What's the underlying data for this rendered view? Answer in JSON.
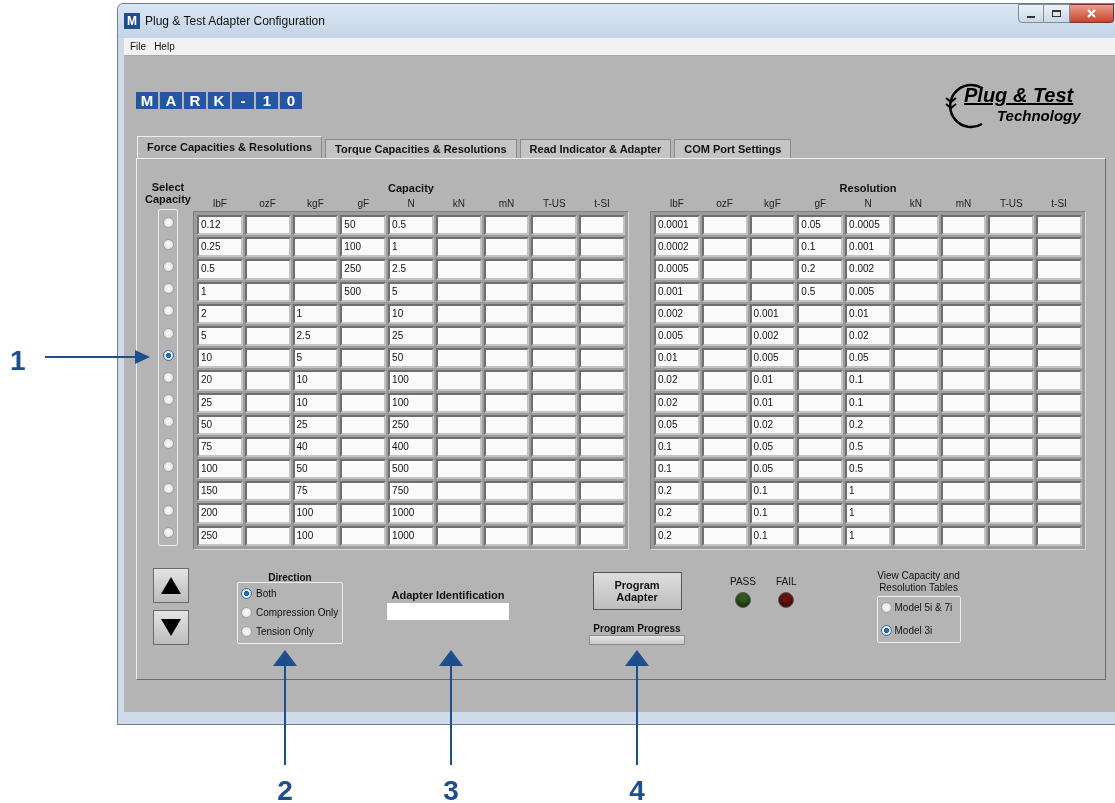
{
  "window": {
    "title": "Plug & Test Adapter Configuration",
    "app_icon": "M"
  },
  "menu": [
    "File",
    "Help"
  ],
  "logo": {
    "letters": [
      "M",
      "A",
      "R",
      "K",
      "-",
      "1",
      "0"
    ]
  },
  "product_logo": {
    "title": "Plug & Test",
    "subtitle": "Technology"
  },
  "tabs": [
    {
      "label": "Force Capacities & Resolutions",
      "selected": true
    },
    {
      "label": "Torque Capacities & Resolutions",
      "selected": false
    },
    {
      "label": "Read Indicator & Adapter",
      "selected": false
    },
    {
      "label": "COM Port Settings",
      "selected": false
    }
  ],
  "select_capacity_label": "Select Capacity",
  "capacity": {
    "title": "Capacity",
    "columns": [
      "lbF",
      "ozF",
      "kgF",
      "gF",
      "N",
      "kN",
      "mN",
      "T-US",
      "t-SI"
    ]
  },
  "resolution": {
    "title": "Resolution",
    "columns": [
      "lbF",
      "ozF",
      "kgF",
      "gF",
      "N",
      "kN",
      "mN",
      "T-US",
      "t-SI"
    ]
  },
  "rows": [
    {
      "selected": false,
      "capacity": {
        "0": "0.12",
        "3": "50",
        "4": "0.5"
      },
      "resolution": {
        "0": "0.0001",
        "3": "0.05",
        "4": "0.0005"
      }
    },
    {
      "selected": false,
      "capacity": {
        "0": "0.25",
        "3": "100",
        "4": "1"
      },
      "resolution": {
        "0": "0.0002",
        "3": "0.1",
        "4": "0.001"
      }
    },
    {
      "selected": false,
      "capacity": {
        "0": "0.5",
        "3": "250",
        "4": "2.5"
      },
      "resolution": {
        "0": "0.0005",
        "3": "0.2",
        "4": "0.002"
      }
    },
    {
      "selected": false,
      "capacity": {
        "0": "1",
        "3": "500",
        "4": "5"
      },
      "resolution": {
        "0": "0.001",
        "3": "0.5",
        "4": "0.005"
      }
    },
    {
      "selected": false,
      "capacity": {
        "0": "2",
        "2": "1",
        "4": "10"
      },
      "resolution": {
        "0": "0.002",
        "2": "0.001",
        "4": "0.01"
      }
    },
    {
      "selected": false,
      "capacity": {
        "0": "5",
        "2": "2.5",
        "4": "25"
      },
      "resolution": {
        "0": "0.005",
        "2": "0.002",
        "4": "0.02"
      }
    },
    {
      "selected": true,
      "capacity": {
        "0": "10",
        "2": "5",
        "4": "50"
      },
      "resolution": {
        "0": "0.01",
        "2": "0.005",
        "4": "0.05"
      }
    },
    {
      "selected": false,
      "capacity": {
        "0": "20",
        "2": "10",
        "4": "100"
      },
      "resolution": {
        "0": "0.02",
        "2": "0.01",
        "4": "0.1"
      }
    },
    {
      "selected": false,
      "capacity": {
        "0": "25",
        "2": "10",
        "4": "100"
      },
      "resolution": {
        "0": "0.02",
        "2": "0.01",
        "4": "0.1"
      }
    },
    {
      "selected": false,
      "capacity": {
        "0": "50",
        "2": "25",
        "4": "250"
      },
      "resolution": {
        "0": "0.05",
        "2": "0.02",
        "4": "0.2"
      }
    },
    {
      "selected": false,
      "capacity": {
        "0": "75",
        "2": "40",
        "4": "400"
      },
      "resolution": {
        "0": "0.1",
        "2": "0.05",
        "4": "0.5"
      }
    },
    {
      "selected": false,
      "capacity": {
        "0": "100",
        "2": "50",
        "4": "500"
      },
      "resolution": {
        "0": "0.1",
        "2": "0.05",
        "4": "0.5"
      }
    },
    {
      "selected": false,
      "capacity": {
        "0": "150",
        "2": "75",
        "4": "750"
      },
      "resolution": {
        "0": "0.2",
        "2": "0.1",
        "4": "1"
      }
    },
    {
      "selected": false,
      "capacity": {
        "0": "200",
        "2": "100",
        "4": "1000"
      },
      "resolution": {
        "0": "0.2",
        "2": "0.1",
        "4": "1"
      }
    },
    {
      "selected": false,
      "capacity": {
        "0": "250",
        "2": "100",
        "4": "1000"
      },
      "resolution": {
        "0": "0.2",
        "2": "0.1",
        "4": "1"
      }
    }
  ],
  "direction": {
    "label": "Direction",
    "options": [
      {
        "label": "Both",
        "selected": true
      },
      {
        "label": "Compression Only",
        "selected": false
      },
      {
        "label": "Tension Only",
        "selected": false
      }
    ]
  },
  "adapter_identification": {
    "label": "Adapter Identification"
  },
  "program_button": "Program Adapter",
  "program_progress": {
    "label": "Program Progress",
    "level": 0
  },
  "indicators": [
    {
      "label": "PASS",
      "on": false,
      "color": "#2f5a1e"
    },
    {
      "label": "FAIL",
      "on": false,
      "color": "#6a1212"
    }
  ],
  "view_tables": {
    "label": "View Capacity and Resolution Tables",
    "options": [
      {
        "label": "Model 5i & 7i",
        "selected": false
      },
      {
        "label": "Model 3i",
        "selected": true
      }
    ]
  },
  "callouts": [
    "1",
    "2",
    "3",
    "4"
  ]
}
